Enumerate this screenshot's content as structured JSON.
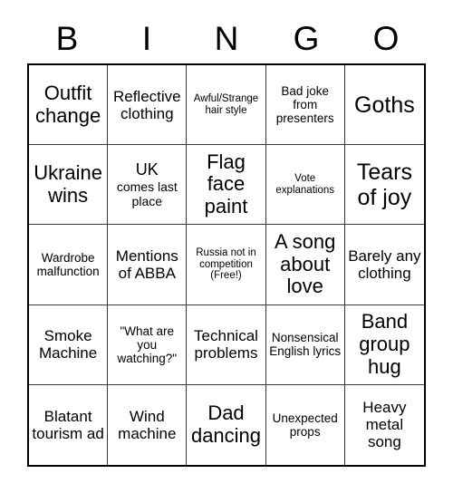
{
  "header": {
    "letters": [
      "B",
      "I",
      "N",
      "G",
      "O"
    ]
  },
  "grid": {
    "rows": 5,
    "columns": 5,
    "cells": [
      {
        "text": "Outfit change",
        "size": "lg"
      },
      {
        "text": "Reflective clothing",
        "size": "md"
      },
      {
        "text": "Awful/Strange hair style",
        "size": "xs"
      },
      {
        "text": "Bad joke from presenters",
        "size": "sm"
      },
      {
        "text": "Goths",
        "size": "xl"
      },
      {
        "text": "Ukraine wins",
        "size": "lg"
      },
      {
        "text": "UK comes last place",
        "size": "mixed",
        "lead": "UK",
        "rest": "comes last place"
      },
      {
        "text": "Flag face paint",
        "size": "lg"
      },
      {
        "text": "Vote explanations",
        "size": "xs"
      },
      {
        "text": "Tears of joy",
        "size": "xl"
      },
      {
        "text": "Wardrobe malfunction",
        "size": "sm"
      },
      {
        "text": "Mentions of ABBA",
        "size": "md"
      },
      {
        "text": "Russia not in competition (Free!)",
        "size": "xs"
      },
      {
        "text": "A song about love",
        "size": "lg"
      },
      {
        "text": "Barely any clothing",
        "size": "md"
      },
      {
        "text": "Smoke Machine",
        "size": "md"
      },
      {
        "text": "\"What are you watching?\"",
        "size": "sm"
      },
      {
        "text": "Technical problems",
        "size": "md"
      },
      {
        "text": "Nonsensical English lyrics",
        "size": "sm"
      },
      {
        "text": "Band group hug",
        "size": "lg"
      },
      {
        "text": "Blatant tourism ad",
        "size": "md"
      },
      {
        "text": "Wind machine",
        "size": "md"
      },
      {
        "text": "Dad dancing",
        "size": "lg"
      },
      {
        "text": "Unexpected props",
        "size": "sm"
      },
      {
        "text": "Heavy metal song",
        "size": "md"
      }
    ]
  },
  "colors": {
    "background": "#ffffff",
    "text": "#000000",
    "grid_outer_border": "#000000",
    "grid_inner_border": "#3a3a3a"
  }
}
